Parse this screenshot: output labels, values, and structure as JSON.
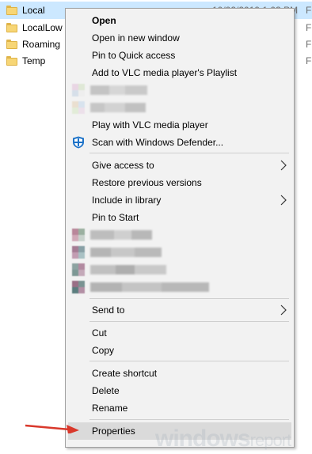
{
  "files": [
    {
      "name": "Local",
      "date": "10/02/2019 1:03 PM",
      "type": "F",
      "selected": true
    },
    {
      "name": "LocalLow",
      "type": "F"
    },
    {
      "name": "Roaming",
      "type": "F"
    },
    {
      "name": "Temp",
      "type": "F"
    }
  ],
  "icons": {
    "folder": "folder-icon",
    "defender": "windows-defender-icon",
    "submenu": "chevron-right-icon"
  },
  "menu": {
    "open": "Open",
    "open_new_window": "Open in new window",
    "pin_quick_access": "Pin to Quick access",
    "vlc_playlist": "Add to VLC media player's Playlist",
    "vlc_play": "Play with VLC media player",
    "scan_defender": "Scan with Windows Defender...",
    "give_access": "Give access to",
    "restore_versions": "Restore previous versions",
    "include_library": "Include in library",
    "pin_start": "Pin to Start",
    "send_to": "Send to",
    "cut": "Cut",
    "copy": "Copy",
    "create_shortcut": "Create shortcut",
    "delete": "Delete",
    "rename": "Rename",
    "properties": "Properties"
  },
  "watermark": {
    "bold": "windows",
    "thin": "report"
  },
  "colors": {
    "selection": "#cce8ff",
    "menu_bg": "#f2f2f2",
    "hover": "#dadada",
    "arrow": "#d9382b",
    "defender_blue": "#1e73c8"
  }
}
